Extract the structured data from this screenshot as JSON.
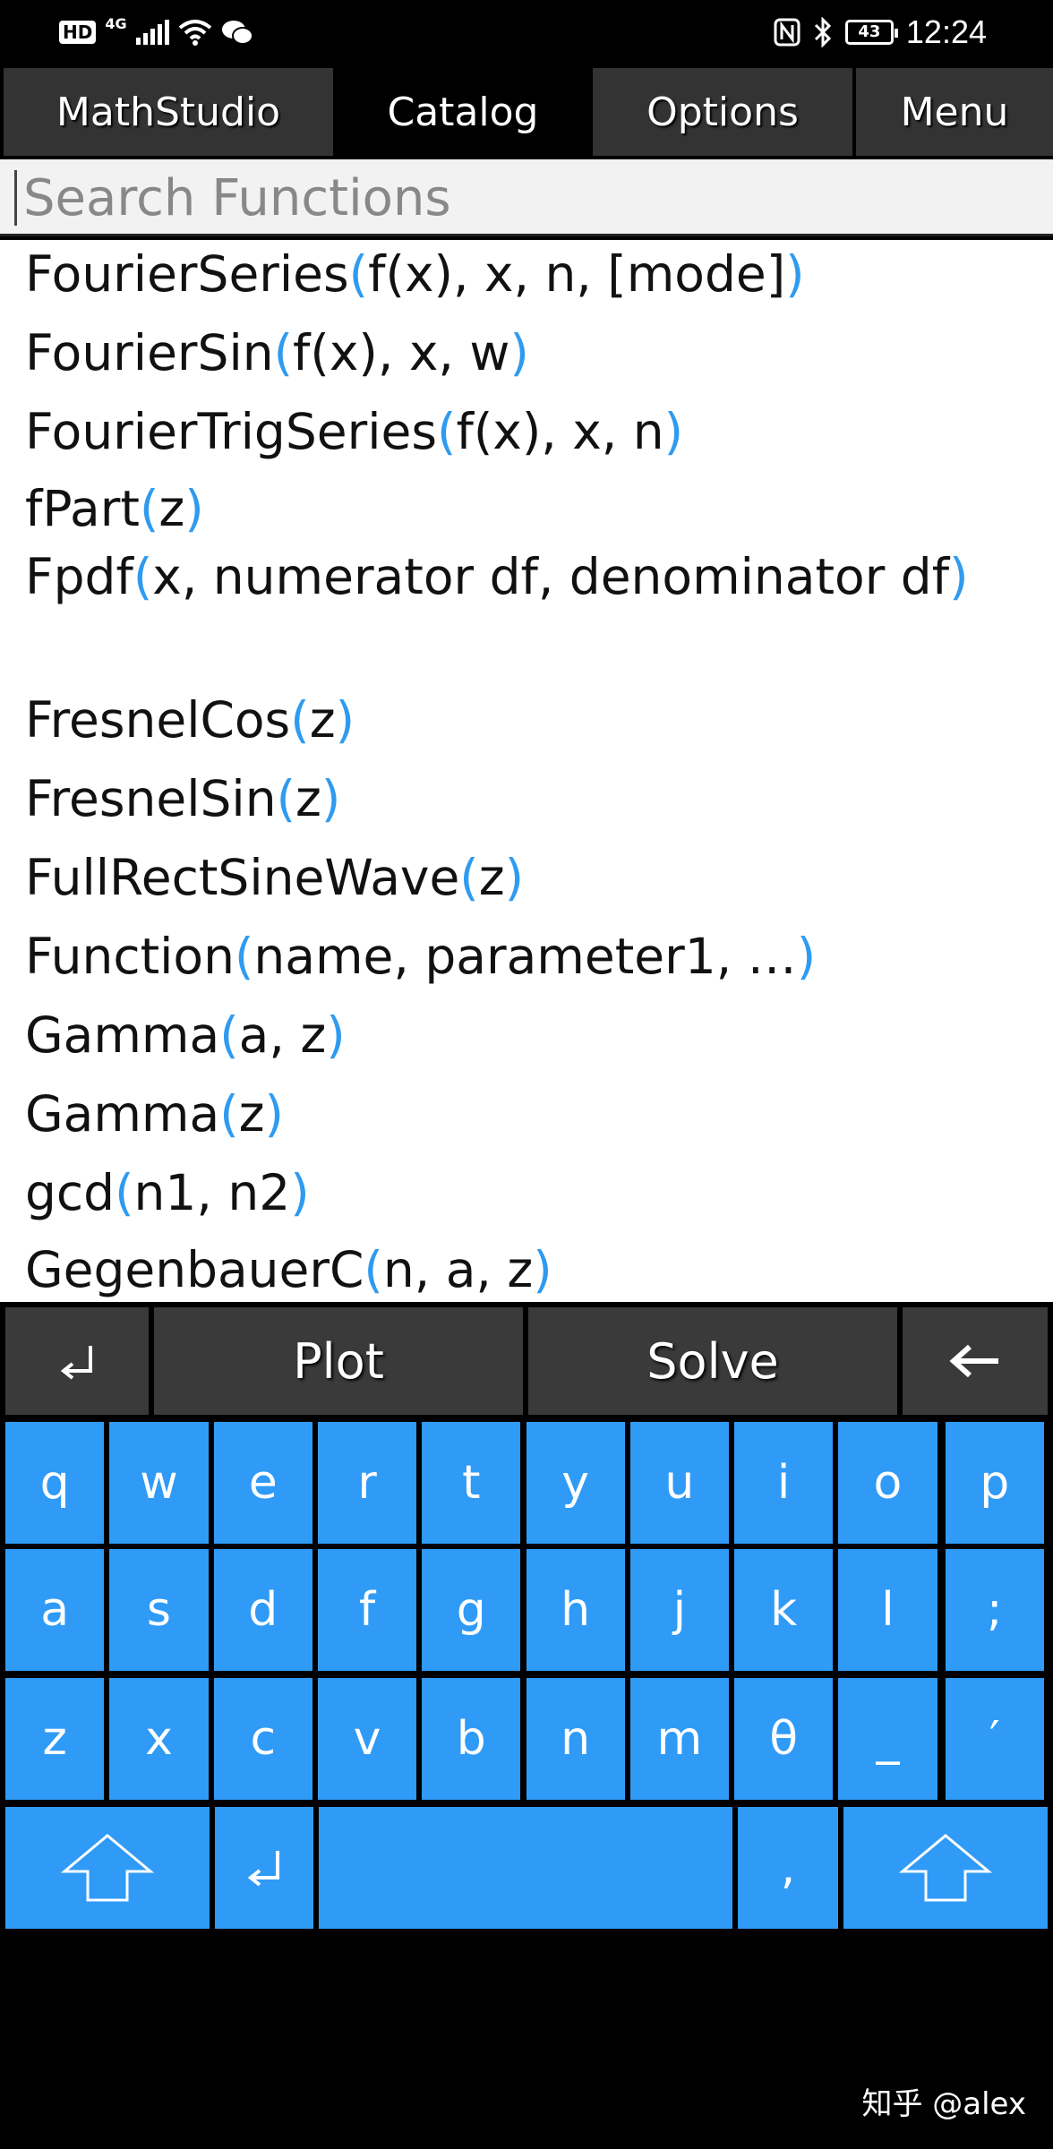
{
  "status_bar": {
    "hd": "HD",
    "network": "4G",
    "battery": "43",
    "time": "12:24"
  },
  "tabs": [
    {
      "label": "MathStudio",
      "active": false
    },
    {
      "label": "Catalog",
      "active": true
    },
    {
      "label": "Options",
      "active": false
    },
    {
      "label": "Menu",
      "active": false
    }
  ],
  "search": {
    "placeholder": "Search Functions",
    "value": ""
  },
  "functions": [
    {
      "name": "FourierSeries",
      "args": "f(x), x, n, [mode]"
    },
    {
      "name": "FourierSin",
      "args": "f(x), x, w"
    },
    {
      "name": "FourierTrigSeries",
      "args": "f(x), x, n"
    },
    {
      "name": "fPart",
      "args": "z"
    },
    {
      "name": "Fpdf",
      "args": "x, numerator df, denominator df"
    },
    {
      "name": "FresnelCos",
      "args": "z"
    },
    {
      "name": "FresnelSin",
      "args": "z"
    },
    {
      "name": "FullRectSineWave",
      "args": "z"
    },
    {
      "name": "Function",
      "args": "name, parameter1, …"
    },
    {
      "name": "Gamma",
      "args": "a, z"
    },
    {
      "name": "Gamma",
      "args": "z"
    },
    {
      "name": "gcd",
      "args": "n1, n2"
    },
    {
      "name": "GegenbauerC",
      "args": "n, a, z"
    }
  ],
  "actions": {
    "enter": "↲",
    "plot": "Plot",
    "solve": "Solve",
    "backspace": "←"
  },
  "keyboard": {
    "row1": [
      "q",
      "w",
      "e",
      "r",
      "t",
      "y",
      "u",
      "i",
      "o",
      "p"
    ],
    "row2": [
      "a",
      "s",
      "d",
      "f",
      "g",
      "h",
      "j",
      "k",
      "l",
      ";"
    ],
    "row3": [
      "z",
      "x",
      "c",
      "v",
      "b",
      "n",
      "m",
      "θ",
      "_",
      "′"
    ],
    "row4": {
      "enter": "↲",
      "space": "",
      "comma": ","
    }
  },
  "watermark": "知乎 @alex",
  "colors": {
    "accent": "#2f9bf7",
    "paren": "#2f9bf0",
    "tab_bg": "#333333",
    "key_bg": "#2f9bf7"
  }
}
